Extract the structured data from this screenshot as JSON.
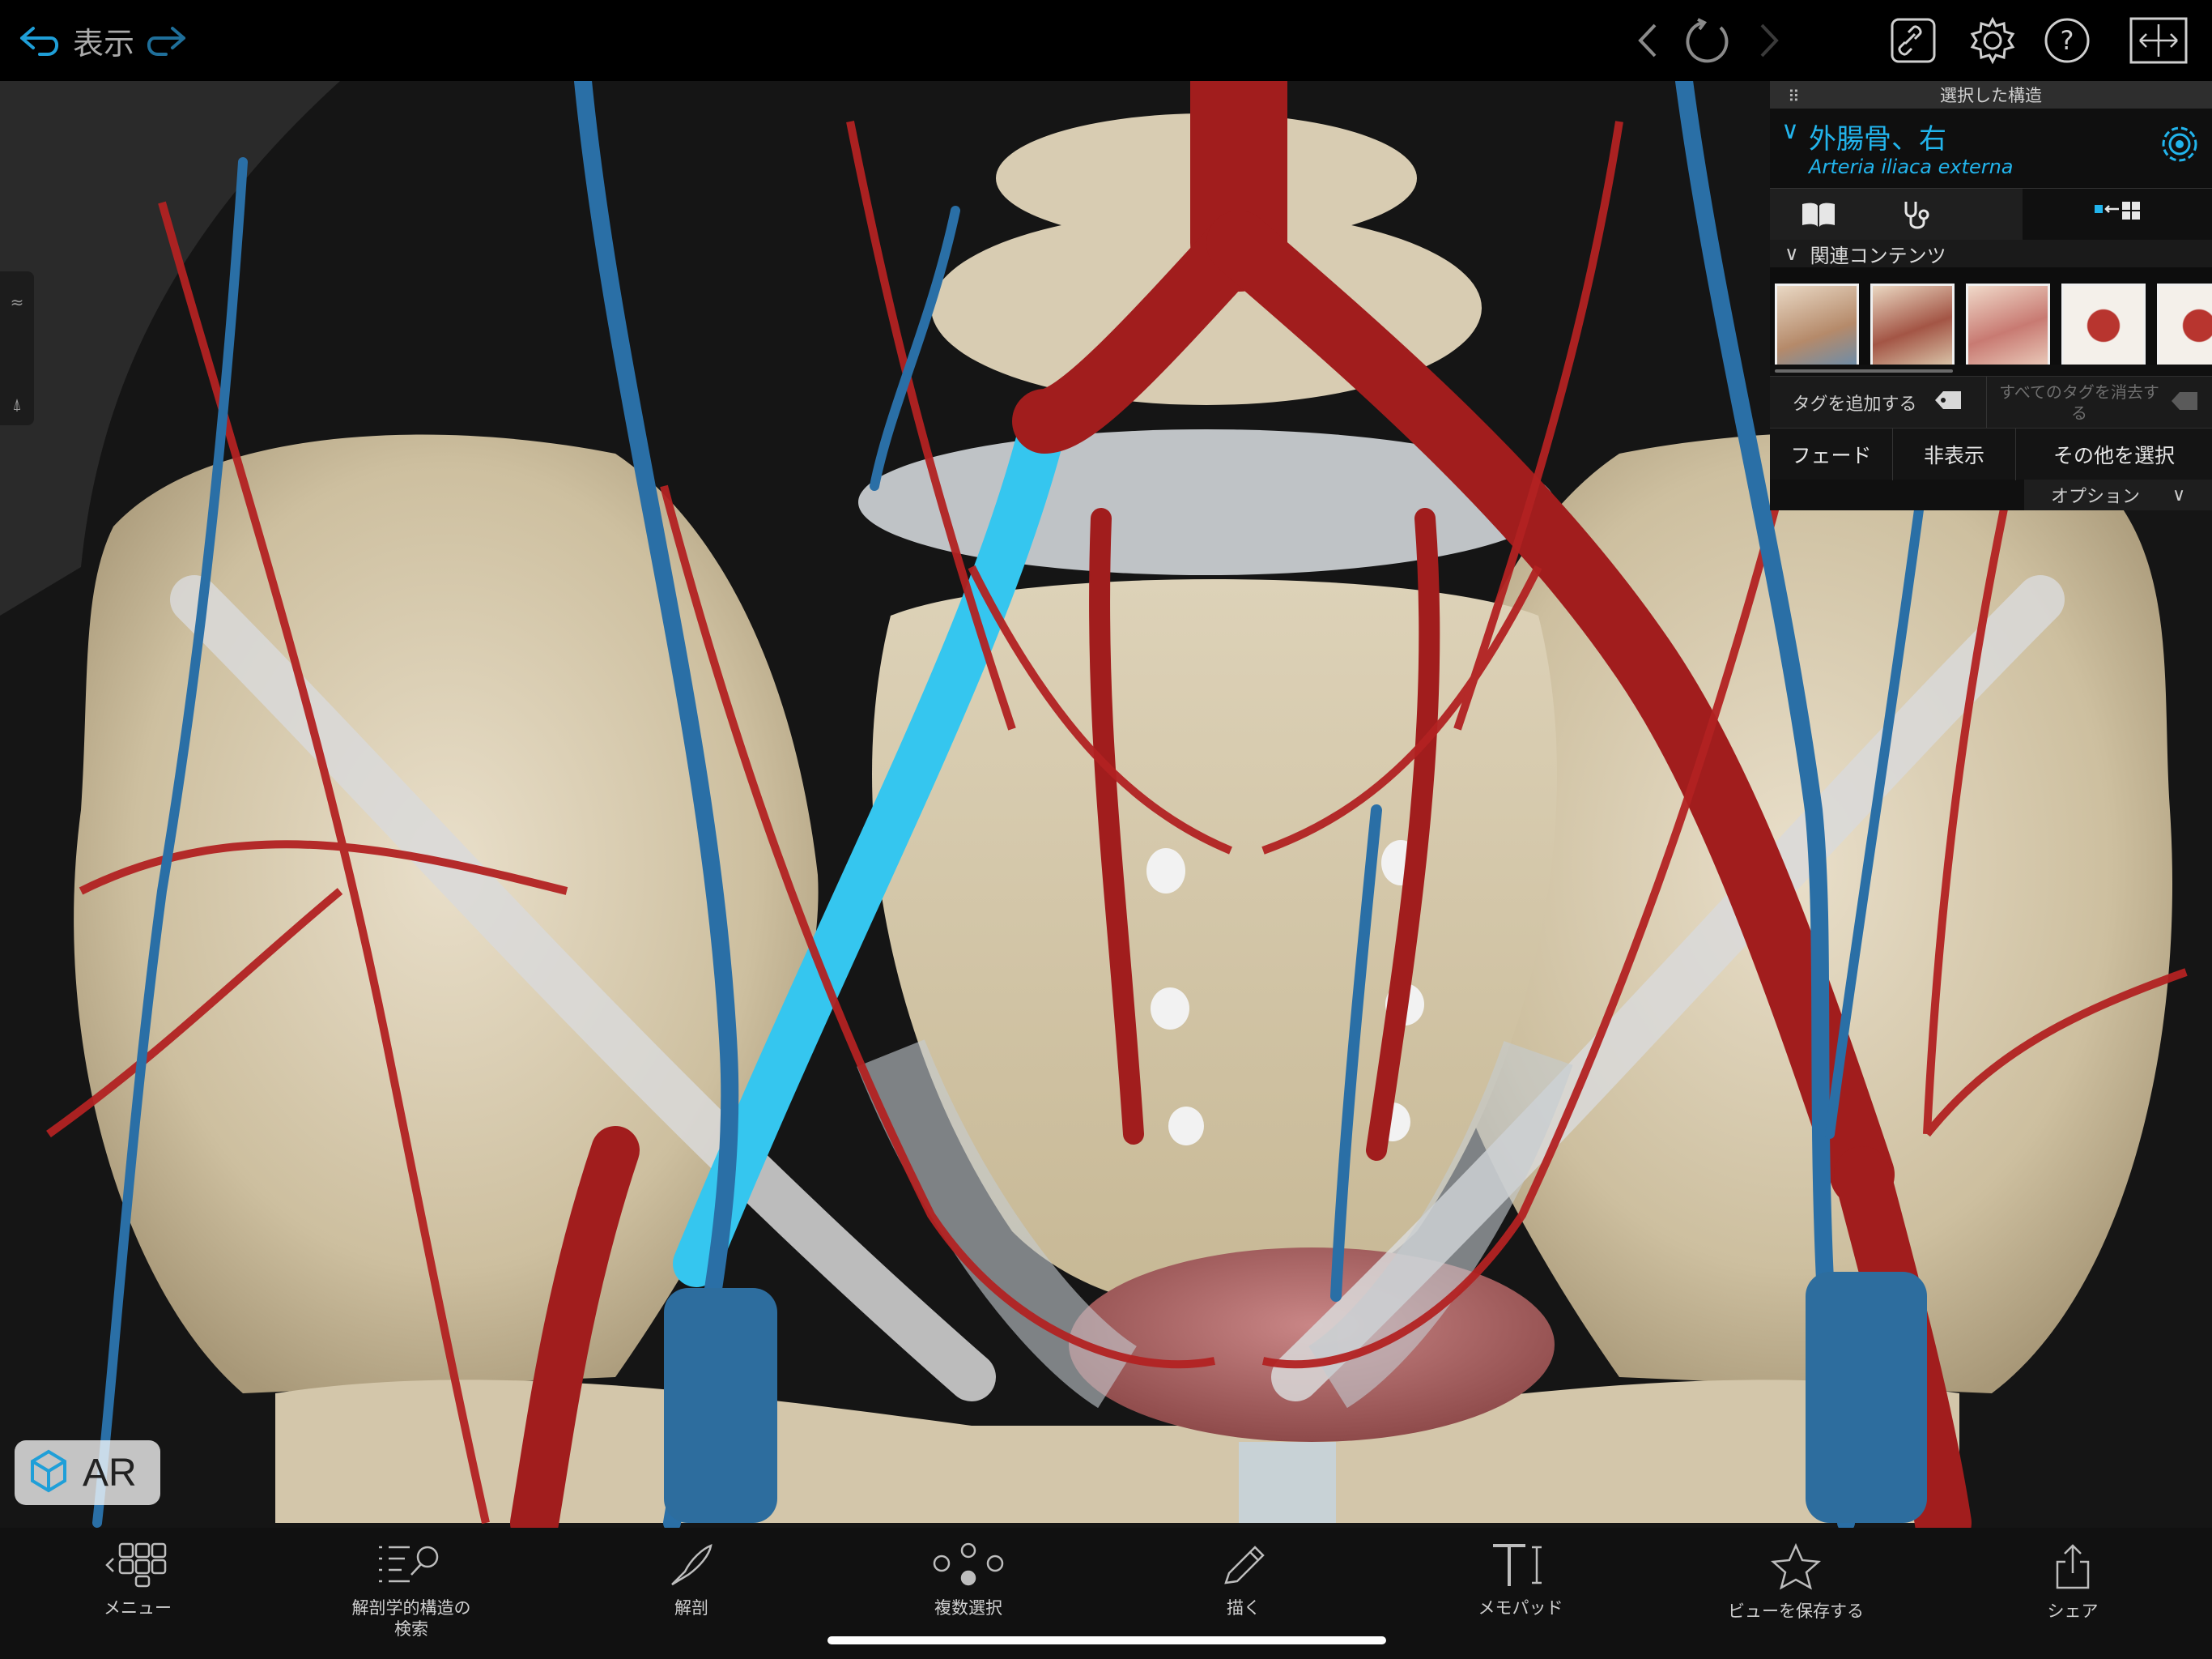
{
  "topbar": {
    "show_label": "表示",
    "icons": [
      "undo-arrow-icon",
      "redo-arrow-icon",
      "back-chevron-icon",
      "reset-rotation-icon",
      "forward-chevron-icon",
      "link-icon",
      "gear-icon",
      "help-icon",
      "fullscreen-icon"
    ]
  },
  "side_handle": {
    "top_glyph": "≈",
    "bottom_glyph": "⍋"
  },
  "panel": {
    "header": "選択した構造",
    "structure_name": "外腸骨、右",
    "latin_name": "Arteria iliaca externa",
    "related_header": "関連コンテンツ",
    "add_tag": "タグを追加する",
    "clear_tags": "すべてのタグを消去する",
    "fade": "フェード",
    "hide": "非表示",
    "select_others": "その他を選択",
    "options": "オプション",
    "accent": "#22b4ec"
  },
  "ar": {
    "label": "AR"
  },
  "bottombar": {
    "menu": "メニュー",
    "search": "解剖学的構造の\n検索",
    "dissect": "解剖",
    "multi_select": "複数選択",
    "draw": "描く",
    "notepad": "メモパッド",
    "save_view": "ビューを保存する",
    "share": "シェア"
  }
}
